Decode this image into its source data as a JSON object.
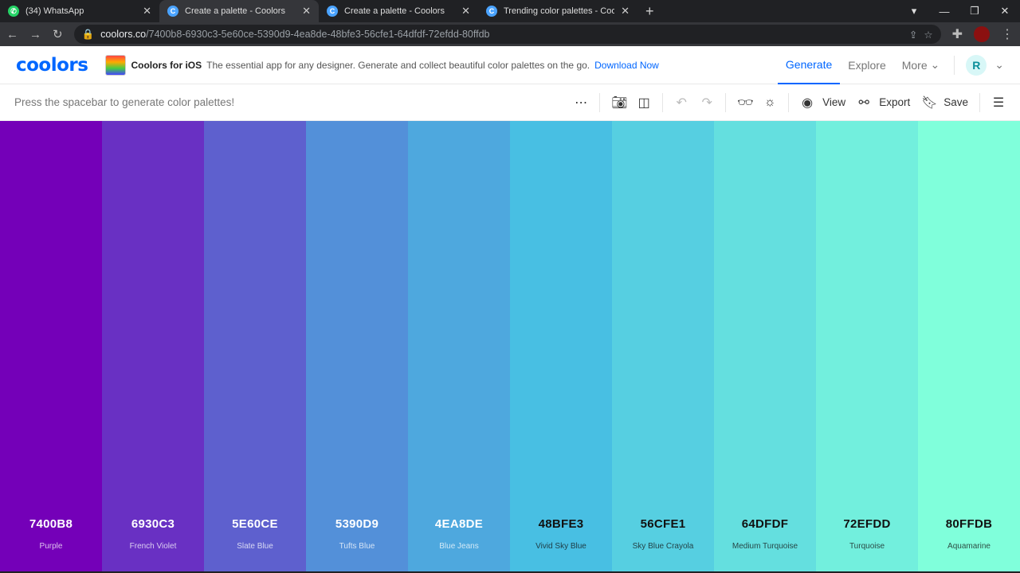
{
  "browser": {
    "tabs": [
      {
        "title": "(34) WhatsApp",
        "icon": "whatsapp-icon"
      },
      {
        "title": "Create a palette - Coolors",
        "icon": "coolors-icon",
        "active": true
      },
      {
        "title": "Create a palette - Coolors",
        "icon": "coolors-icon"
      },
      {
        "title": "Trending color palettes - Coolors",
        "icon": "coolors-icon"
      }
    ],
    "url_host": "coolors.co",
    "url_path": "/7400b8-6930c3-5e60ce-5390d9-4ea8de-48bfe3-56cfe1-64dfdf-72efdd-80ffdb"
  },
  "header": {
    "logo": "coolors",
    "promo_title": "Coolors for iOS",
    "promo_text": "The essential app for any designer. Generate and collect beautiful color palettes on the go.",
    "promo_link": "Download Now",
    "nav": [
      "Generate",
      "Explore",
      "More"
    ],
    "avatar": "R",
    "accent": "#0066ff"
  },
  "toolbar": {
    "hint": "Press the spacebar to generate color palettes!",
    "view": "View",
    "export": "Export",
    "save": "Save"
  },
  "palette": [
    {
      "hex": "7400B8",
      "name": "Purple",
      "color": "#7400b8",
      "text": "#fff"
    },
    {
      "hex": "6930C3",
      "name": "French Violet",
      "color": "#6930c3",
      "text": "#fff"
    },
    {
      "hex": "5E60CE",
      "name": "Slate Blue",
      "color": "#5e60ce",
      "text": "#fff"
    },
    {
      "hex": "5390D9",
      "name": "Tufts Blue",
      "color": "#5390d9",
      "text": "#fff"
    },
    {
      "hex": "4EA8DE",
      "name": "Blue Jeans",
      "color": "#4ea8de",
      "text": "#fff"
    },
    {
      "hex": "48BFE3",
      "name": "Vivid Sky Blue",
      "color": "#48bfe3",
      "text": "#111"
    },
    {
      "hex": "56CFE1",
      "name": "Sky Blue Crayola",
      "color": "#56cfe1",
      "text": "#111"
    },
    {
      "hex": "64DFDF",
      "name": "Medium Turquoise",
      "color": "#64dfdf",
      "text": "#111"
    },
    {
      "hex": "72EFDD",
      "name": "Turquoise",
      "color": "#72efdd",
      "text": "#111"
    },
    {
      "hex": "80FFDB",
      "name": "Aquamarine",
      "color": "#80ffdb",
      "text": "#111"
    }
  ]
}
